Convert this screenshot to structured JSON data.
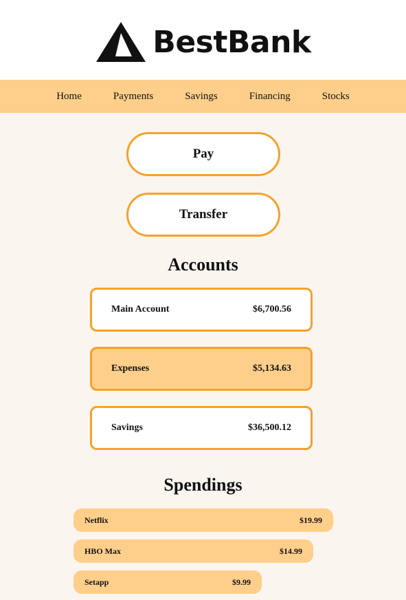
{
  "brand": {
    "name": "BestBank",
    "logo_icon": "triangle-logo-icon",
    "accent": "#f6a12a",
    "nav_bg": "#fecf8b"
  },
  "nav": {
    "items": [
      "Home",
      "Payments",
      "Savings",
      "Financing",
      "Stocks"
    ]
  },
  "actions": {
    "pay_label": "Pay",
    "transfer_label": "Transfer"
  },
  "accounts": {
    "title": "Accounts",
    "items": [
      {
        "name": "Main Account",
        "amount": "$6,700.56"
      },
      {
        "name": "Expenses",
        "amount": "$5,134.63"
      },
      {
        "name": "Savings",
        "amount": "$36,500.12"
      }
    ]
  },
  "spendings": {
    "title": "Spendings",
    "items": [
      {
        "name": "Netflix",
        "amount": "$19.99",
        "share": 1.0
      },
      {
        "name": "HBO Max",
        "amount": "$14.99",
        "share": 0.75
      },
      {
        "name": "Setapp",
        "amount": "$9.99",
        "share": 0.5
      }
    ]
  }
}
